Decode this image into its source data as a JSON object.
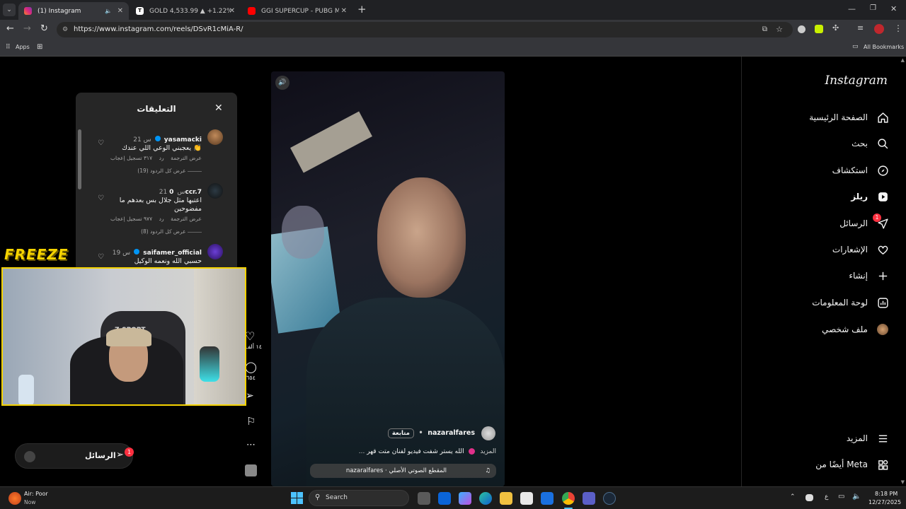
{
  "browser": {
    "tabs": [
      {
        "title": "(1) Instagram",
        "active": true
      },
      {
        "title": "GOLD 4,533.99 ▲ +1.22% Unn",
        "active": false
      },
      {
        "title": "GGI SUPERCUP - PUBG Mobile",
        "active": false
      }
    ],
    "new_tab": "+",
    "url": "https://www.instagram.com/reels/DSvR1cMiA-R/",
    "bookmarks": {
      "apps": "Apps",
      "all": "All Bookmarks"
    }
  },
  "sidebar": {
    "logo": "Instagram",
    "items": [
      {
        "label": "الصفحة الرئيسية",
        "icon": "home-icon"
      },
      {
        "label": "بحث",
        "icon": "search-icon"
      },
      {
        "label": "استكشاف",
        "icon": "compass-icon"
      },
      {
        "label": "ريلز",
        "icon": "reels-icon"
      },
      {
        "label": "الرسائل",
        "icon": "messages-icon",
        "badge": "1"
      },
      {
        "label": "الإشعارات",
        "icon": "heart-icon"
      },
      {
        "label": "إنشاء",
        "icon": "plus-icon"
      },
      {
        "label": "لوحة المعلومات",
        "icon": "dashboard-icon"
      },
      {
        "label": "ملف شخصي",
        "icon": "avatar-icon"
      }
    ],
    "more": "المزيد",
    "meta": "أيضًا من Meta"
  },
  "comments": {
    "title": "التعليقات",
    "items": [
      {
        "user": "yasamacki",
        "time": "21 س",
        "text": "يعجبني الوعي اللي عندك 👏",
        "likes": "٣١٧ تسجيل إعجاب",
        "reply": "رد",
        "translate": "عرض الترجمة",
        "replies": "عرض كل الردود (19)"
      },
      {
        "user": "0ccr.7",
        "time": "21 س",
        "text": "اعتبها مثل جلال بس بعدهم ما مفضوحين",
        "likes": "٩٧٧ تسجيل إعجاب",
        "reply": "رد",
        "translate": "عرض الترجمة",
        "replies": "عرض كل الردود (8)"
      },
      {
        "user": "saifamer_official",
        "time": "19 س",
        "text": "حسبي الله ونعمه الوكيل"
      }
    ]
  },
  "reel": {
    "username": "nazaralfares",
    "follow": "متابعة",
    "caption": "الله يستر شفت فيديو لفنان متت قهر",
    "more": "... المزيد",
    "audio": "nazaralfares · المقطع الصوتي الأصلي",
    "likes_count": "١٤ ألف",
    "comments_count": "٦٥٤"
  },
  "overlay": {
    "freeze": "FREEZE",
    "chair_brand": "Z-SPORT"
  },
  "messages_pill": {
    "label": "الرسائل",
    "badge": "1"
  },
  "taskbar": {
    "weather_title": "Air: Poor",
    "weather_sub": "Now",
    "search": "Search",
    "time": "8:18 PM",
    "date": "12/27/2025",
    "lang": "ع"
  },
  "colors": {
    "accent_yellow": "#f5d300",
    "badge_red": "#ff3040",
    "verified_blue": "#0095f6"
  }
}
